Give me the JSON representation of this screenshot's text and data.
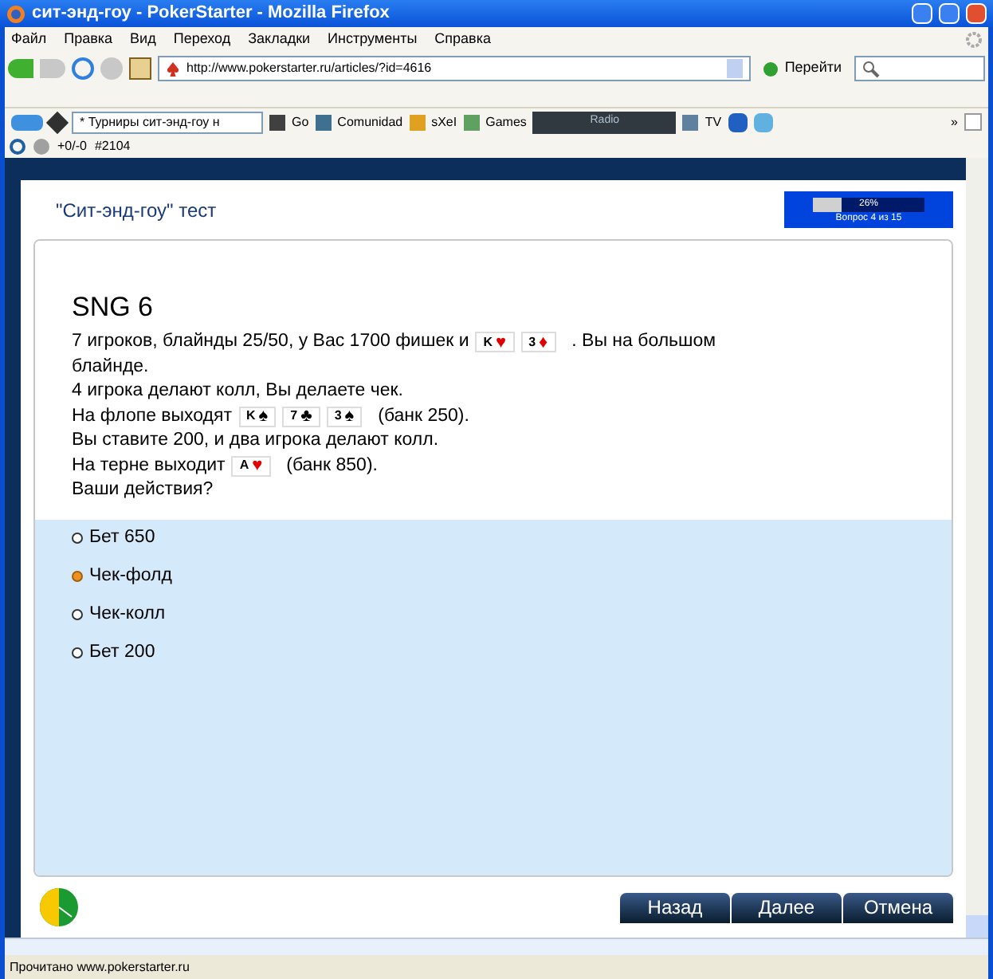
{
  "window": {
    "title": "сит-энд-гоу - PokerStarter - Mozilla Firefox"
  },
  "menu": [
    "Файл",
    "Правка",
    "Вид",
    "Переход",
    "Закладки",
    "Инструменты",
    "Справка"
  ],
  "nav": {
    "url": "http://www.pokerstarter.ru/articles/?id=4616",
    "go": "Перейти"
  },
  "toolbar": {
    "tournaments": "* Турниры сит-энд-гоу н",
    "go": "Go",
    "community": "Comunidad",
    "sxe": "sXeI",
    "games": "Games",
    "radio": "Radio",
    "tv": "TV",
    "more": "»"
  },
  "small_toolbar": {
    "score": "+0/-0",
    "rank": "#2104"
  },
  "page": {
    "title": "\"Сит-энд-гоу\" тест",
    "progress": {
      "level": 0.26,
      "percent": "26%",
      "question": "Вопрос 4 из 15"
    },
    "heading": "SNG 6",
    "lines": [
      [
        {
          "kind": "text",
          "text": "7 игроков, блайнды 25/50, у Вас 1700 фишек и"
        },
        {
          "kind": "card",
          "rank": "K",
          "suit": "♥",
          "color": "#e00000"
        },
        {
          "kind": "card",
          "rank": "3",
          "suit": "♦",
          "color": "#e00000"
        },
        {
          "kind": "text",
          "text": ". Вы на большом"
        }
      ],
      [
        {
          "kind": "text",
          "text": "блайнде."
        }
      ],
      [
        {
          "kind": "text",
          "text": "4 игрока делают колл, Вы делаете чек."
        }
      ],
      [
        {
          "kind": "text",
          "text": "На флопе выходят"
        },
        {
          "kind": "card",
          "rank": "K",
          "suit": "♠",
          "color": "#000000"
        },
        {
          "kind": "card",
          "rank": "7",
          "suit": "♣",
          "color": "#000000"
        },
        {
          "kind": "card",
          "rank": "3",
          "suit": "♠",
          "color": "#000000"
        },
        {
          "kind": "text",
          "text": "(банк 250)."
        }
      ],
      [
        {
          "kind": "text",
          "text": "Вы ставите 200, и два игрока делают колл."
        }
      ],
      [
        {
          "kind": "text",
          "text": "На терне выходит"
        },
        {
          "kind": "card",
          "rank": "A",
          "suit": "♥",
          "color": "#e00000"
        },
        {
          "kind": "text",
          "text": "(банк 850)."
        }
      ],
      [
        {
          "kind": "text",
          "text": "Ваши действия?"
        }
      ]
    ],
    "options": [
      {
        "label": "Бет 650",
        "selected": false
      },
      {
        "label": "Чек-фолд",
        "selected": true
      },
      {
        "label": "Чек-колл",
        "selected": false
      },
      {
        "label": "Бет 200",
        "selected": false
      }
    ],
    "buttons": [
      "Назад",
      "Далее",
      "Отмена"
    ]
  },
  "status_bar": "Прочитано www.pokerstarter.ru"
}
